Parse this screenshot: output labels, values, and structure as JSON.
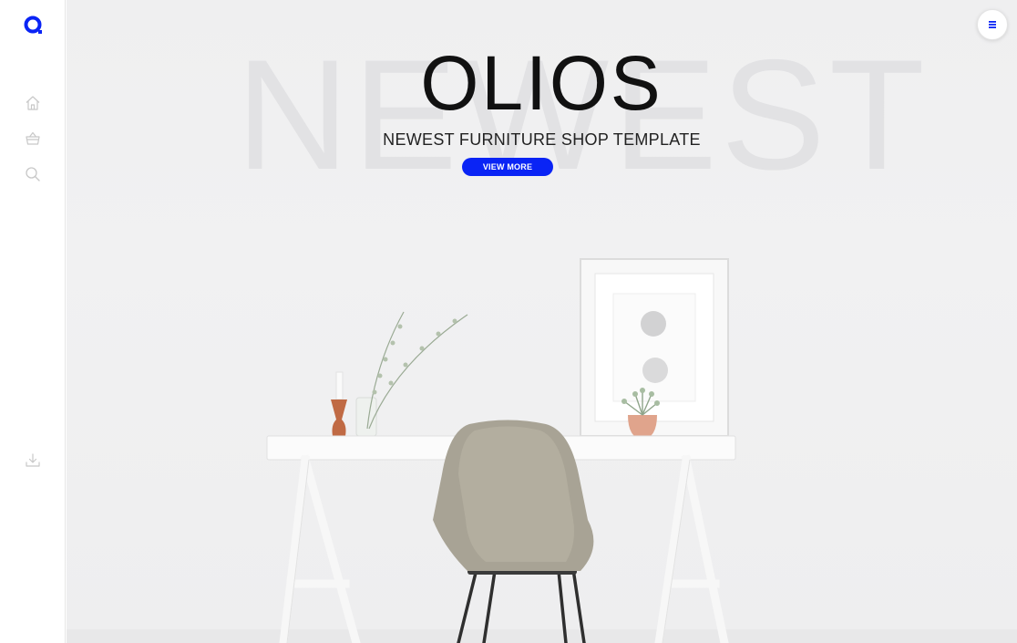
{
  "sidebar": {
    "logo_icon": "brand-circle-logo",
    "icons": [
      "home-icon",
      "shopping-basket-icon",
      "search-icon",
      "download-icon"
    ]
  },
  "hero": {
    "ghost_word": "NEWEST",
    "brand": "OLIOS",
    "tagline": "NEWEST FURNITURE SHOP TEMPLATE",
    "cta_label": "VIEW MORE",
    "menu_icon": "hamburger-menu-icon"
  },
  "colors": {
    "accent": "#0a24f5",
    "background": "#f0f0f1",
    "sidebar_icon": "#c8c8c8"
  }
}
